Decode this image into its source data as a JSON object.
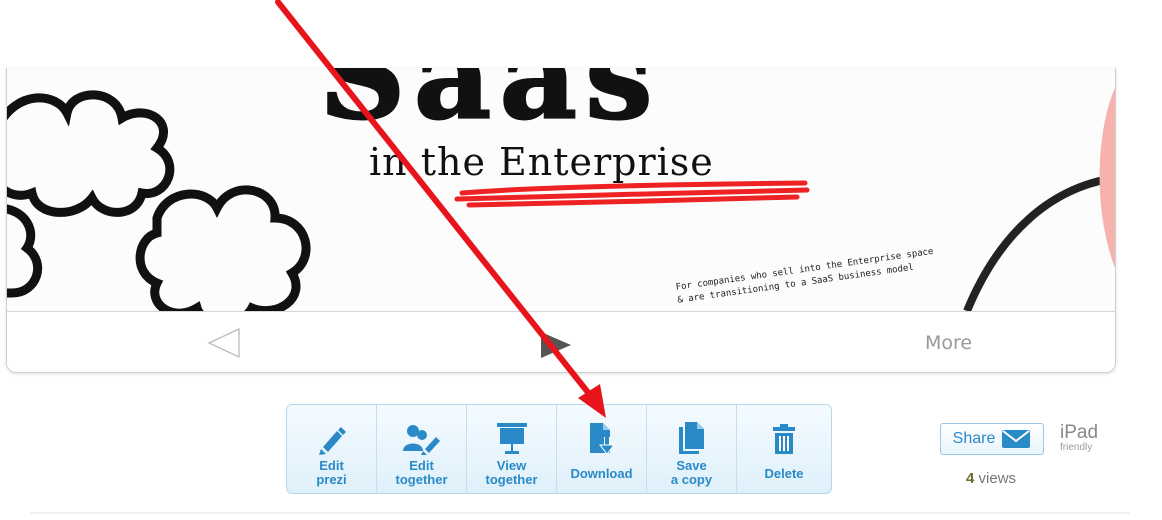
{
  "slide": {
    "title_partial": "Saas",
    "subtitle": "in the Enterprise",
    "tagline_line1": "For companies who sell into the Enterprise space",
    "tagline_line2": "& are transitioning to a SaaS business model"
  },
  "controls": {
    "more_label": "More"
  },
  "toolbar": {
    "buttons": [
      {
        "label_line1": "Edit",
        "label_line2": "prezi",
        "icon": "pencil-icon"
      },
      {
        "label_line1": "Edit",
        "label_line2": "together",
        "icon": "users-pencil-icon"
      },
      {
        "label_line1": "View",
        "label_line2": "together",
        "icon": "presentation-screen-icon"
      },
      {
        "label": "Download",
        "icon": "download-file-icon"
      },
      {
        "label_line1": "Save",
        "label_line2": "a copy",
        "icon": "copy-document-icon"
      },
      {
        "label": "Delete",
        "icon": "trash-icon"
      }
    ]
  },
  "share": {
    "label": "Share",
    "icon": "envelope-icon"
  },
  "ipad": {
    "label": "iPad",
    "sub": "friendly"
  },
  "stats": {
    "views_count": "4",
    "views_label": "views"
  },
  "colors": {
    "accent": "#2a8ac8",
    "annotation_arrow": "#e8141b",
    "toolbar_bg": "#e4f3fb"
  }
}
